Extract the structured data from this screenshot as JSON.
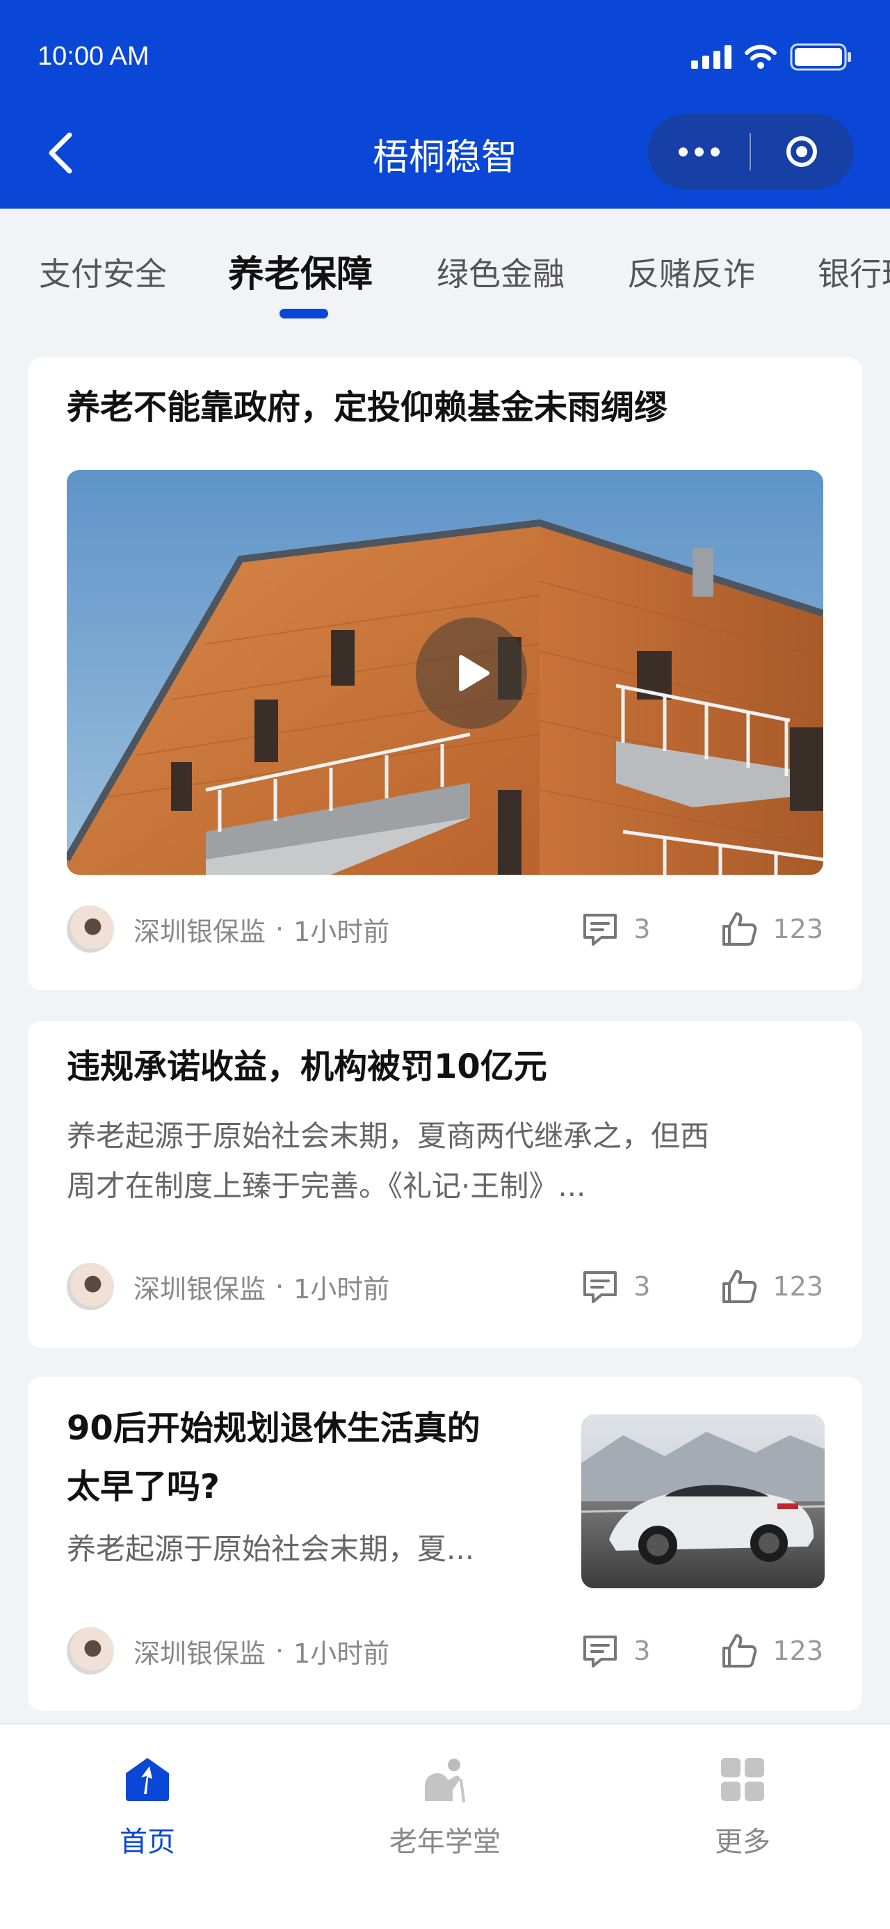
{
  "status_bar": {
    "time": "10:00 AM"
  },
  "header": {
    "title": "梧桐稳智"
  },
  "tabs": [
    {
      "label": "支付安全",
      "active": false
    },
    {
      "label": "养老保障",
      "active": true
    },
    {
      "label": "绿色金融",
      "active": false
    },
    {
      "label": "反赌反诈",
      "active": false
    },
    {
      "label": "银行理财",
      "active": false
    }
  ],
  "articles": [
    {
      "title": "养老不能靠政府，定投仰赖基金未雨绸缪",
      "source": "深圳银保监",
      "separator": "·",
      "time": "1小时前",
      "comments": "3",
      "likes": "123",
      "media": "video"
    },
    {
      "title": "违规承诺收益，机构被罚10亿元",
      "summary_line1": "养老起源于原始社会末期，夏商两代继承之，但西",
      "summary_line2": "周才在制度上臻于完善。《礼记·王制》...",
      "source": "深圳银保监",
      "separator": "·",
      "time": "1小时前",
      "comments": "3",
      "likes": "123"
    },
    {
      "title_line1": "90后开始规划退休生活真的",
      "title_line2": "太早了吗?",
      "summary": "养老起源于原始社会末期，夏...",
      "source": "深圳银保监",
      "separator": "·",
      "time": "1小时前",
      "comments": "3",
      "likes": "123",
      "media": "image"
    }
  ],
  "bottom_nav": [
    {
      "label": "首页",
      "icon": "home-icon",
      "active": true
    },
    {
      "label": "老年学堂",
      "icon": "elder-icon",
      "active": false
    },
    {
      "label": "更多",
      "icon": "grid-icon",
      "active": false
    }
  ],
  "colors": {
    "brand": "#0a47d6",
    "capsule": "#1640a6",
    "background": "#f2f3f7"
  }
}
